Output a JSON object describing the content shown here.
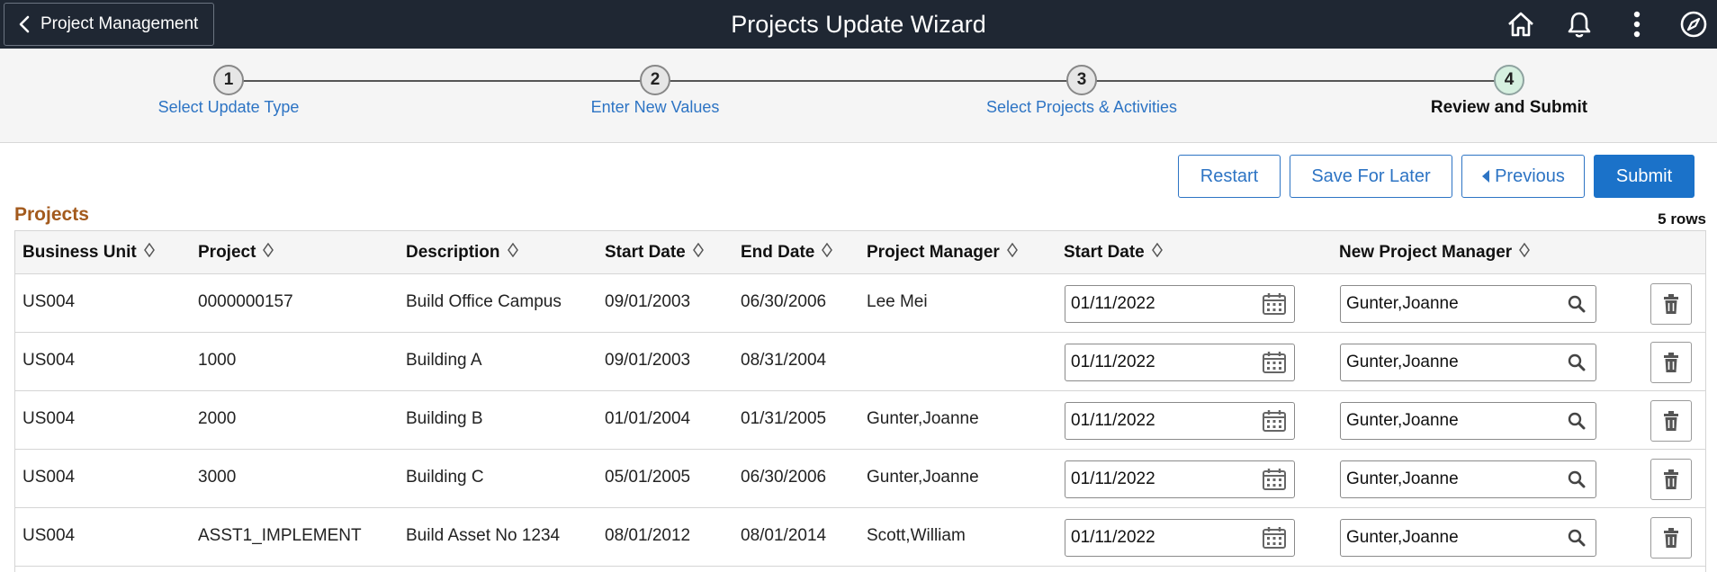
{
  "header": {
    "back_label": "Project Management",
    "title": "Projects Update Wizard",
    "icons": [
      "home-icon",
      "bell-icon",
      "more-vertical-icon",
      "compass-icon"
    ]
  },
  "steps": [
    {
      "number": "1",
      "label": "Select Update Type"
    },
    {
      "number": "2",
      "label": "Enter New Values"
    },
    {
      "number": "3",
      "label": "Select Projects & Activities"
    },
    {
      "number": "4",
      "label": "Review and Submit",
      "current": true
    }
  ],
  "toolbar": {
    "restart_label": "Restart",
    "save_later_label": "Save For Later",
    "previous_label": "Previous",
    "submit_label": "Submit"
  },
  "grid": {
    "title": "Projects",
    "row_count": "5 rows",
    "columns": [
      "Business Unit",
      "Project",
      "Description",
      "Start Date",
      "End Date",
      "Project Manager",
      "Start Date",
      "New Project Manager"
    ],
    "rows": [
      {
        "business_unit": "US004",
        "project": "0000000157",
        "description": "Build Office Campus",
        "start_date": "09/01/2003",
        "end_date": "06/30/2006",
        "project_manager": "Lee Mei",
        "new_start_date": "01/11/2022",
        "new_project_manager": "Gunter,Joanne"
      },
      {
        "business_unit": "US004",
        "project": "1000",
        "description": "Building A",
        "start_date": "09/01/2003",
        "end_date": "08/31/2004",
        "project_manager": "",
        "new_start_date": "01/11/2022",
        "new_project_manager": "Gunter,Joanne"
      },
      {
        "business_unit": "US004",
        "project": "2000",
        "description": "Building B",
        "start_date": "01/01/2004",
        "end_date": "01/31/2005",
        "project_manager": "Gunter,Joanne",
        "new_start_date": "01/11/2022",
        "new_project_manager": "Gunter,Joanne"
      },
      {
        "business_unit": "US004",
        "project": "3000",
        "description": "Building C",
        "start_date": "05/01/2005",
        "end_date": "06/30/2006",
        "project_manager": "Gunter,Joanne",
        "new_start_date": "01/11/2022",
        "new_project_manager": "Gunter,Joanne"
      },
      {
        "business_unit": "US004",
        "project": "ASST1_IMPLEMENT",
        "description": "Build Asset No 1234",
        "start_date": "08/01/2012",
        "end_date": "08/01/2014",
        "project_manager": "Scott,William",
        "new_start_date": "01/11/2022",
        "new_project_manager": "Gunter,Joanne"
      }
    ]
  },
  "colors": {
    "header_bg": "#1f2733",
    "link_blue": "#2d74c4",
    "primary_button": "#1b72c9",
    "section_title": "#a35a1d"
  }
}
